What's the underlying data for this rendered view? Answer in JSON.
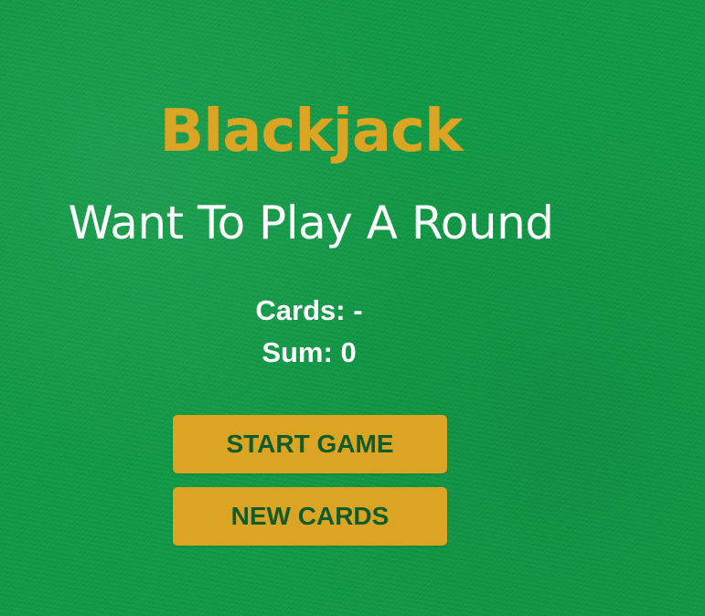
{
  "title": "Blackjack",
  "message": "Want To Play A Round",
  "cards": {
    "label": "Cards:",
    "value": "-"
  },
  "sum": {
    "label": "Sum:",
    "value": "0"
  },
  "buttons": {
    "start_label": "START GAME",
    "new_cards_label": "NEW CARDS"
  },
  "colors": {
    "felt": "#0f9a45",
    "accent": "#dba523",
    "button_text": "#0f5c2a",
    "text": "#ffffff"
  }
}
